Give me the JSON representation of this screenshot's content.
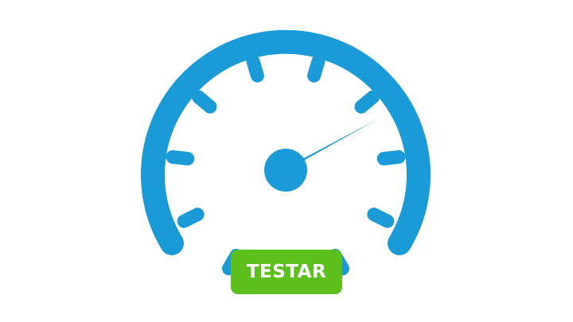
{
  "gauge": {
    "icon": "speedometer-icon",
    "color": "#1a9ad7",
    "tick_count": 10
  },
  "button": {
    "label": "TESTAR",
    "color": "#5cbf1c",
    "text_color": "#ffffff"
  }
}
